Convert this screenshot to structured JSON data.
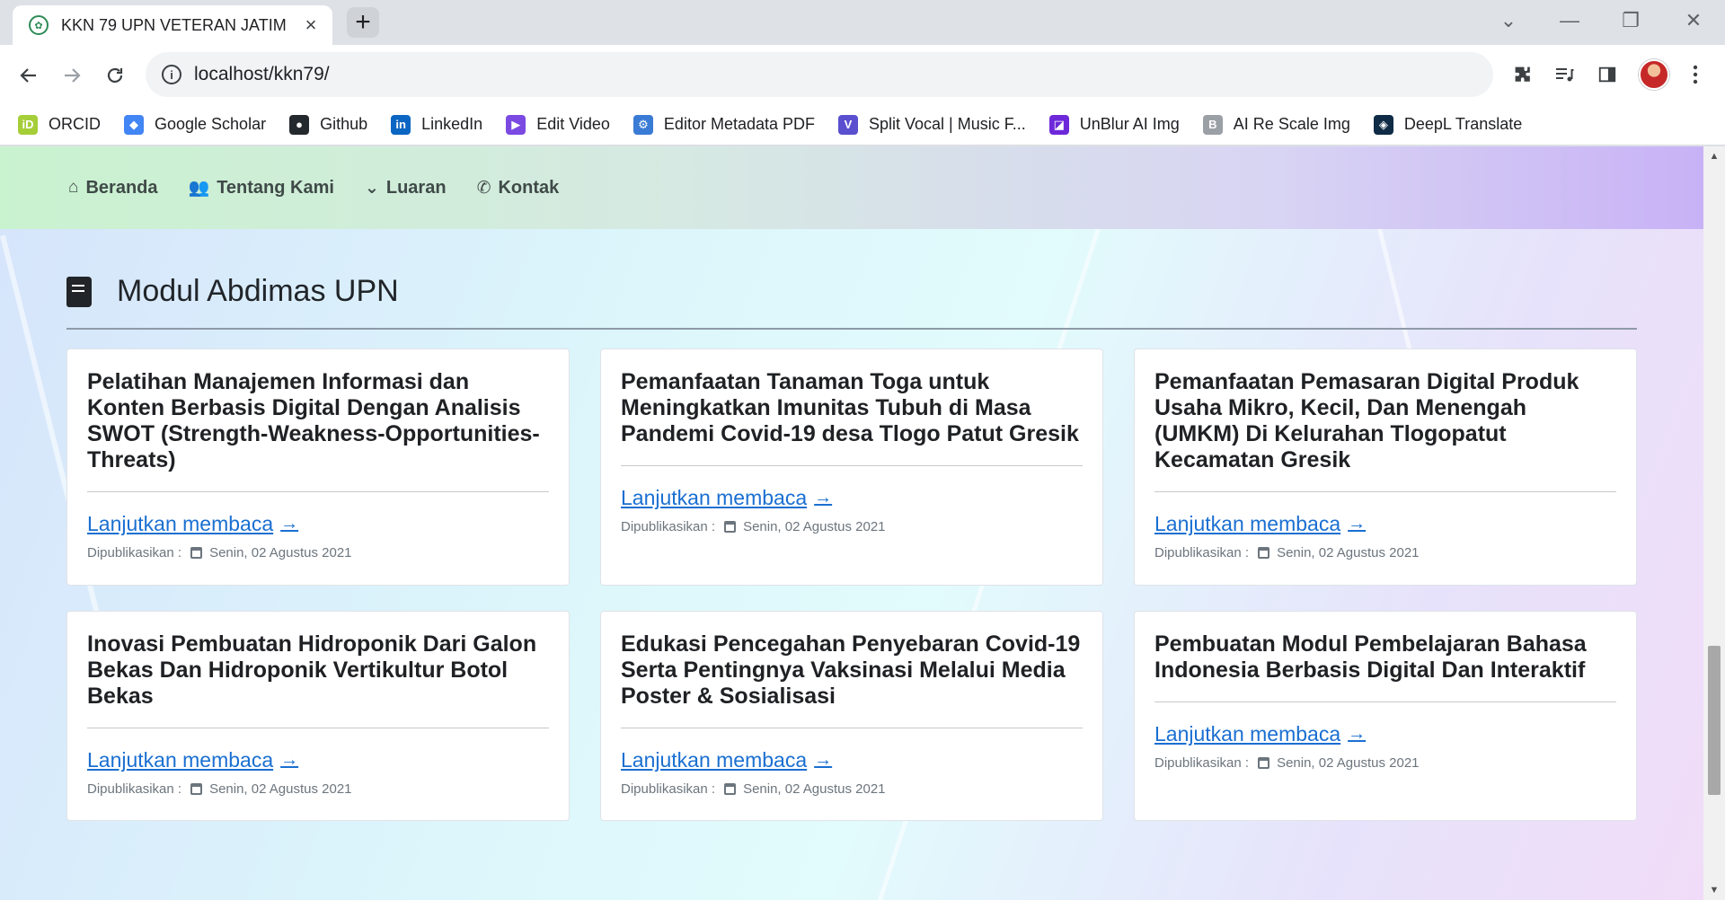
{
  "browser": {
    "tab_title": "KKN 79 UPN VETERAN JATIM",
    "tab_close": "×",
    "new_tab": "+",
    "url": "localhost/kkn79/",
    "window_controls": {
      "collapse": "⌄",
      "minimize": "—",
      "restore": "❐",
      "close": "✕"
    }
  },
  "bookmarks": [
    {
      "label": "ORCID",
      "icon": "orcid-icon",
      "glyph": "iD",
      "color": "#a6ce39"
    },
    {
      "label": "Google Scholar",
      "icon": "google-scholar-icon",
      "glyph": "◆",
      "color": "#4285f4"
    },
    {
      "label": "Github",
      "icon": "github-icon",
      "glyph": "●",
      "color": "#24292e"
    },
    {
      "label": "LinkedIn",
      "icon": "linkedin-icon",
      "glyph": "in",
      "color": "#0a66c2"
    },
    {
      "label": "Edit Video",
      "icon": "edit-video-icon",
      "glyph": "▶",
      "color": "#7b4ae2"
    },
    {
      "label": "Editor Metadata PDF",
      "icon": "metadata-pdf-icon",
      "glyph": "⚙",
      "color": "#3a7bd5"
    },
    {
      "label": "Split Vocal | Music F...",
      "icon": "split-vocal-icon",
      "glyph": "V",
      "color": "#5a4fcf"
    },
    {
      "label": "UnBlur AI Img",
      "icon": "unblur-icon",
      "glyph": "◪",
      "color": "#6d28d9"
    },
    {
      "label": "AI Re Scale Img",
      "icon": "rescale-icon",
      "glyph": "B",
      "color": "#9aa0a6"
    },
    {
      "label": "DeepL Translate",
      "icon": "deepl-icon",
      "glyph": "◈",
      "color": "#0f2b46"
    }
  ],
  "site_nav": [
    {
      "label": "Beranda",
      "icon": "home-icon",
      "glyph": "⌂"
    },
    {
      "label": "Tentang Kami",
      "icon": "users-icon",
      "glyph": "👥"
    },
    {
      "label": "Luaran",
      "icon": "chevron-down-icon",
      "glyph": "⌄"
    },
    {
      "label": "Kontak",
      "icon": "phone-icon",
      "glyph": "✆"
    }
  ],
  "section": {
    "title": "Modul Abdimas UPN"
  },
  "cards": [
    {
      "title": "Pelatihan Manajemen Informasi dan Konten Berbasis Digital Dengan Analisis SWOT (Strength-Weakness-Opportunities-Threats)",
      "link": "Lanjutkan membaca",
      "published_label": "Dipublikasikan :",
      "date": "Senin, 02 Agustus 2021"
    },
    {
      "title": "Pemanfaatan Tanaman Toga untuk Meningkatkan Imunitas Tubuh di Masa Pandemi Covid-19 desa Tlogo Patut Gresik",
      "link": "Lanjutkan membaca",
      "published_label": "Dipublikasikan :",
      "date": "Senin, 02 Agustus 2021"
    },
    {
      "title": "Pemanfaatan Pemasaran Digital Produk Usaha Mikro, Kecil, Dan Menengah (UMKM) Di Kelurahan Tlogopatut Kecamatan Gresik",
      "link": "Lanjutkan membaca",
      "published_label": "Dipublikasikan :",
      "date": "Senin, 02 Agustus 2021"
    },
    {
      "title": "Inovasi Pembuatan Hidroponik Dari Galon Bekas Dan Hidroponik Vertikultur Botol Bekas",
      "link": "Lanjutkan membaca",
      "published_label": "Dipublikasikan :",
      "date": "Senin, 02 Agustus 2021"
    },
    {
      "title": "Edukasi Pencegahan Penyebaran Covid-19 Serta Pentingnya Vaksinasi Melalui Media Poster & Sosialisasi",
      "link": "Lanjutkan membaca",
      "published_label": "Dipublikasikan :",
      "date": "Senin, 02 Agustus 2021"
    },
    {
      "title": "Pembuatan Modul Pembelajaran Bahasa Indonesia Berbasis Digital Dan Interaktif",
      "link": "Lanjutkan membaca",
      "published_label": "Dipublikasikan :",
      "date": "Senin, 02 Agustus 2021"
    }
  ]
}
